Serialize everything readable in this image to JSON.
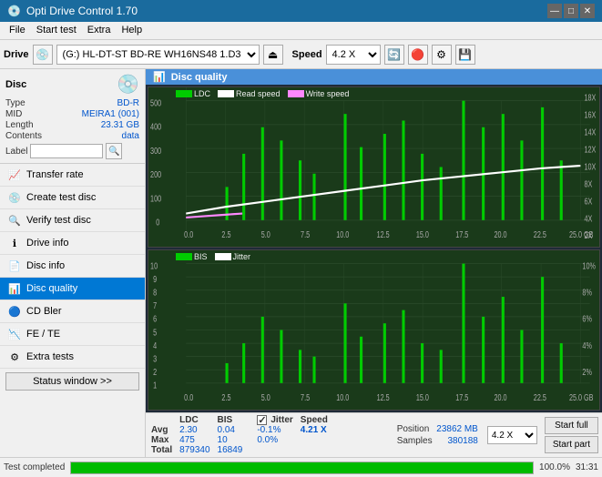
{
  "app": {
    "title": "Opti Drive Control 1.70",
    "icon": "💿"
  },
  "titlebar": {
    "minimize": "—",
    "maximize": "□",
    "close": "✕"
  },
  "menubar": {
    "items": [
      "File",
      "Start test",
      "Extra",
      "Help"
    ]
  },
  "toolbar": {
    "drive_label": "Drive",
    "drive_value": "(G:)  HL-DT-ST BD-RE  WH16NS48 1.D3",
    "speed_label": "Speed",
    "speed_value": "4.2 X"
  },
  "disc": {
    "title": "Disc",
    "type_label": "Type",
    "type_value": "BD-R",
    "mid_label": "MID",
    "mid_value": "MEIRA1 (001)",
    "length_label": "Length",
    "length_value": "23.31 GB",
    "contents_label": "Contents",
    "contents_value": "data",
    "label_label": "Label",
    "label_value": ""
  },
  "nav": {
    "items": [
      {
        "id": "transfer-rate",
        "label": "Transfer rate",
        "icon": "📈"
      },
      {
        "id": "create-test-disc",
        "label": "Create test disc",
        "icon": "💿"
      },
      {
        "id": "verify-test-disc",
        "label": "Verify test disc",
        "icon": "🔍"
      },
      {
        "id": "drive-info",
        "label": "Drive info",
        "icon": "ℹ"
      },
      {
        "id": "disc-info",
        "label": "Disc info",
        "icon": "📄"
      },
      {
        "id": "disc-quality",
        "label": "Disc quality",
        "icon": "📊",
        "active": true
      },
      {
        "id": "cd-bler",
        "label": "CD Bler",
        "icon": "🔵"
      },
      {
        "id": "fe-te",
        "label": "FE / TE",
        "icon": "📉"
      },
      {
        "id": "extra-tests",
        "label": "Extra tests",
        "icon": "⚙"
      }
    ],
    "status_window": "Status window >>"
  },
  "dq": {
    "title": "Disc quality",
    "chart1_legends": [
      {
        "label": "LDC",
        "color": "#00cc00"
      },
      {
        "label": "Read speed",
        "color": "#ffffff"
      },
      {
        "label": "Write speed",
        "color": "#ff88ff"
      }
    ],
    "chart1_ymax": 500,
    "chart1_y_labels": [
      "500",
      "400",
      "300",
      "200",
      "100",
      "0"
    ],
    "chart1_y2_labels": [
      "18X",
      "16X",
      "14X",
      "12X",
      "10X",
      "8X",
      "6X",
      "4X",
      "2X"
    ],
    "chart2_legends": [
      {
        "label": "BIS",
        "color": "#00cc00"
      },
      {
        "label": "Jitter",
        "color": "#ffffff"
      }
    ],
    "chart2_ymax": 10,
    "chart2_y_labels": [
      "10",
      "9",
      "8",
      "7",
      "6",
      "5",
      "4",
      "3",
      "2",
      "1"
    ],
    "chart2_y2_labels": [
      "10%",
      "8%",
      "6%",
      "4%",
      "2%"
    ],
    "x_labels": [
      "0.0",
      "2.5",
      "5.0",
      "7.5",
      "10.0",
      "12.5",
      "15.0",
      "17.5",
      "20.0",
      "22.5",
      "25.0"
    ],
    "x_unit": "GB"
  },
  "stats": {
    "headers": [
      "",
      "LDC",
      "BIS",
      "",
      "Jitter",
      "Speed"
    ],
    "avg_label": "Avg",
    "avg_ldc": "2.30",
    "avg_bis": "0.04",
    "avg_jitter": "-0.1%",
    "max_label": "Max",
    "max_ldc": "475",
    "max_bis": "10",
    "max_jitter": "0.0%",
    "total_label": "Total",
    "total_ldc": "879340",
    "total_bis": "16849",
    "speed_label": "Speed",
    "speed_value": "4.21 X",
    "speed_dropdown": "4.2 X",
    "position_label": "Position",
    "position_value": "23862 MB",
    "samples_label": "Samples",
    "samples_value": "380188",
    "jitter_checked": true,
    "start_full_label": "Start full",
    "start_part_label": "Start part"
  },
  "statusbar": {
    "status_text": "Test completed",
    "progress_pct": "100.0%",
    "progress_value": 100,
    "time": "31:31"
  }
}
